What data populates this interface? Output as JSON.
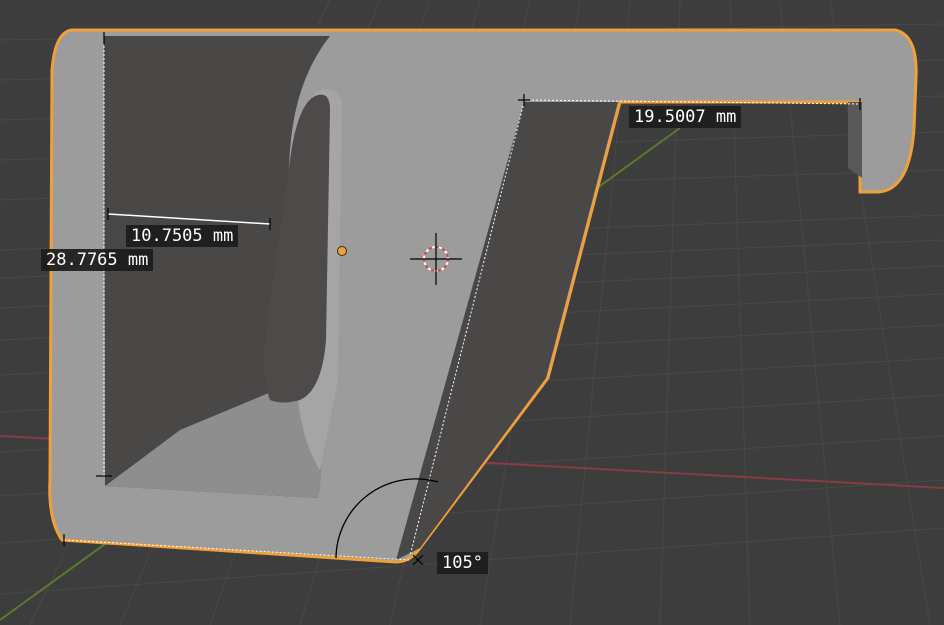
{
  "app": "Blender 3D Viewport",
  "measurements": {
    "top_width": "19.5007 mm",
    "inner_width": "10.7505 mm",
    "height": "28.7765 mm",
    "angle": "105°"
  },
  "colors": {
    "background": "#3d3d3d",
    "grid": "#484848",
    "x_axis": "#8a3b45",
    "y_axis": "#5a7a2c",
    "mesh_face": "#9c9c9c",
    "mesh_shadow": "#4a4747",
    "selection_outline": "#f0a03a",
    "measure_line": "#ffffff",
    "cursor_ring": "#d64545"
  },
  "icons": [
    "3d-cursor-icon",
    "origin-point-icon",
    "measure-endpoint-icon"
  ]
}
